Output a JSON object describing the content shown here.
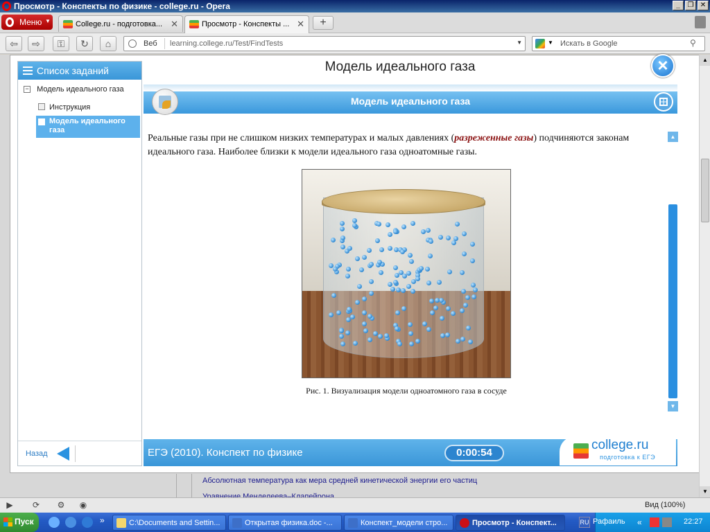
{
  "window": {
    "title": "Просмотр - Конспекты по физике - college.ru - Opera"
  },
  "browser": {
    "menu_label": "Меню",
    "tabs": [
      {
        "label": "College.ru - подготовка..."
      },
      {
        "label": "Просмотр - Конспекты ..."
      }
    ],
    "address": {
      "type_label": "Веб",
      "url": "learning.college.ru/Test/FindTests"
    },
    "search_placeholder": "Искать в Google",
    "status_zoom": "Вид (100%)"
  },
  "left_panel": {
    "header": "Список заданий",
    "root_item": "Модель идеального газа",
    "items": [
      {
        "label": "Инструкция",
        "selected": false
      },
      {
        "label": "Модель идеального газа",
        "selected": true
      }
    ],
    "back_label": "Назад"
  },
  "main": {
    "page_title": "Модель идеального газа",
    "ribbon_title": "Модель идеального газа",
    "paragraph_before": "Реальные газы при не слишком низких температурах и малых давлениях (",
    "paragraph_emphasis": "разреженные газы",
    "paragraph_after": ") подчиняются законам идеального газа. Наиболее близки к модели идеального газа одноатомные газы.",
    "caption": "Рис. 1. Визуализация модели одноатомного газа в сосуде",
    "footer_label": "ЕГЭ (2010). Конспект по физике",
    "timer": "0:00:54",
    "logo_name": "college.ru",
    "logo_sub": "подготовка к ЕГЭ"
  },
  "background_links": [
    "Абсолютная температура как мера средней кинетической энергии его частиц",
    "Уравнение Менделеева–Клапейрона"
  ],
  "taskbar": {
    "start_label": "Пуск",
    "buttons": [
      {
        "label": "C:\\Documents and Settin..."
      },
      {
        "label": "Открытая физика.doc -..."
      },
      {
        "label": "Конспект_модели стро..."
      },
      {
        "label": "Просмотр - Конспект..."
      }
    ],
    "lang": "RU",
    "user": "Рафаиль",
    "clock": "22:27"
  },
  "colors": {
    "accent_blue": "#3a96d8",
    "opera_red": "#cc0f16",
    "emphasis": "#8a1010"
  }
}
